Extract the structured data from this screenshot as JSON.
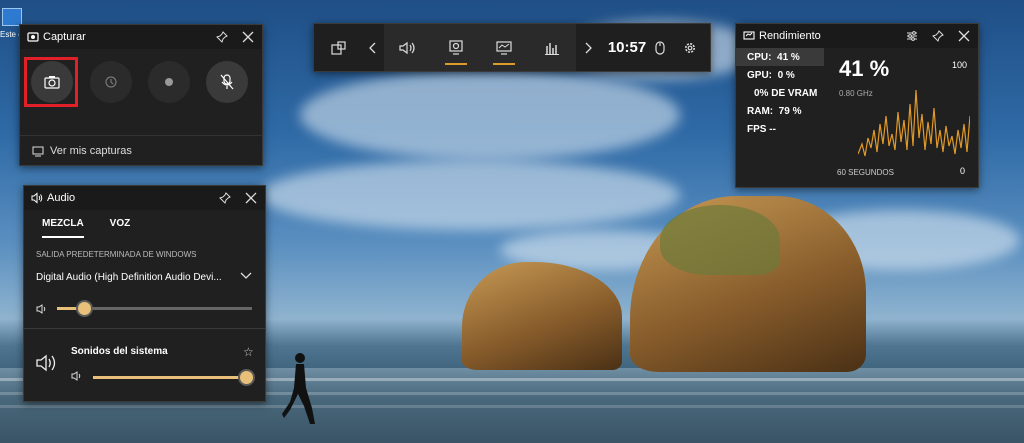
{
  "desktop": {
    "icon_label": "Este eq..."
  },
  "capture": {
    "title": "Capturar",
    "footer_label": "Ver mis capturas"
  },
  "gamebar": {
    "clock": "10:57"
  },
  "performance": {
    "title": "Rendimiento",
    "rows": [
      {
        "label": "CPU:",
        "value": "41 %"
      },
      {
        "label": "GPU:",
        "value": "0 %"
      },
      {
        "label": "",
        "value": "0% DE VRAM"
      },
      {
        "label": "RAM:",
        "value": "79 %"
      },
      {
        "label": "FPS",
        "value": "--"
      }
    ],
    "big_value": "41 %",
    "frequency": "0.80 GHz",
    "scale_max": "100",
    "scale_min": "0",
    "time_window": "60 SEGUNDOS",
    "accent": "#e09a2a"
  },
  "audio": {
    "title": "Audio",
    "tabs": [
      "MEZCLA",
      "VOZ"
    ],
    "section_label": "SALIDA PREDETERMINADA DE WINDOWS",
    "device": "Digital Audio (High Definition Audio Devi...",
    "master_volume": 0.14,
    "app_name": "Sonidos del sistema",
    "app_volume": 1.0,
    "accent": "#e8c07a"
  }
}
